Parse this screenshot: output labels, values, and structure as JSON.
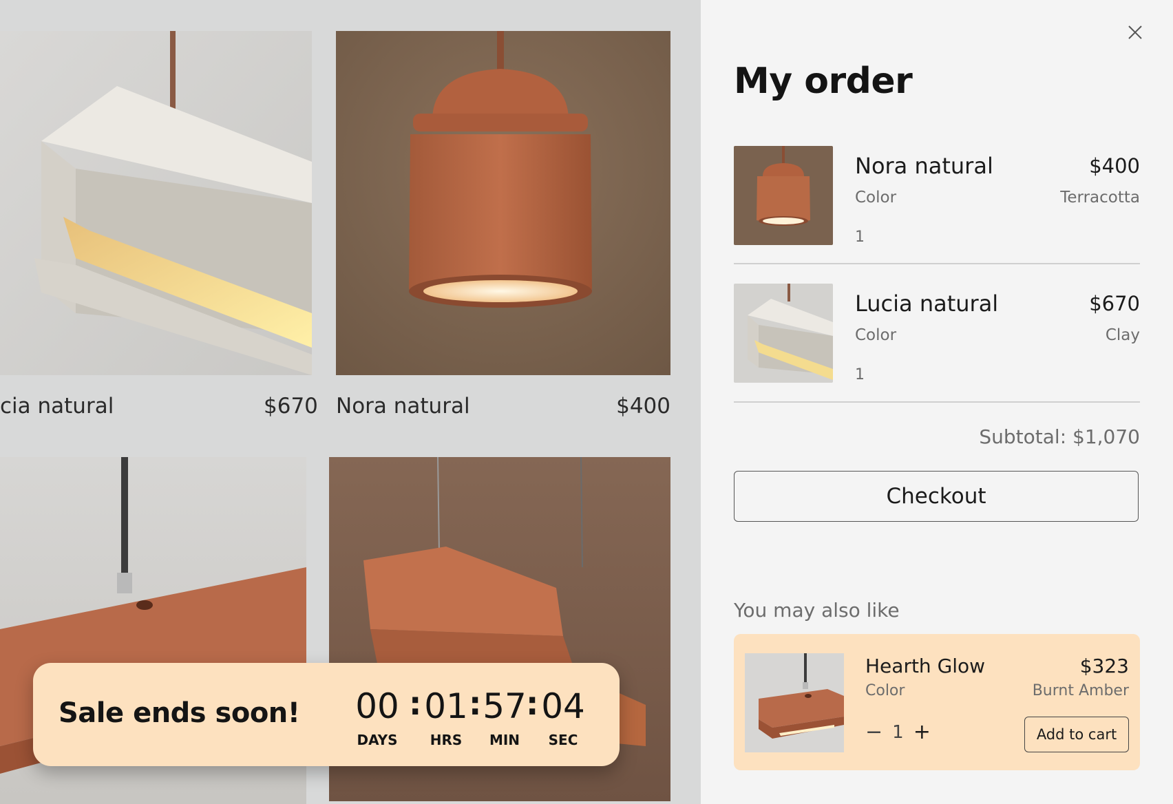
{
  "colors": {
    "banner": "#fde1bf",
    "panel": "#f4f4f4",
    "grid_bg": "#d8d9d9",
    "terracotta": "#b46646"
  },
  "grid": {
    "products": [
      {
        "name": "cia natural",
        "price": "$670"
      },
      {
        "name": "Nora natural",
        "price": "$400"
      }
    ]
  },
  "sale": {
    "text": "Sale ends soon!",
    "countdown": [
      {
        "value": "00",
        "label": "DAYS"
      },
      {
        "value": "01",
        "label": "HRS"
      },
      {
        "value": "57",
        "label": "MIN"
      },
      {
        "value": "04",
        "label": "SEC"
      }
    ],
    "separator": ":"
  },
  "order": {
    "title": "My order",
    "close_icon": "close-icon",
    "items": [
      {
        "name": "Nora natural",
        "price": "$400",
        "color_label": "Color",
        "color": "Terracotta",
        "qty": "1"
      },
      {
        "name": "Lucia natural",
        "price": "$670",
        "color_label": "Color",
        "color": "Clay",
        "qty": "1"
      }
    ],
    "subtotal": "Subtotal: $1,070",
    "checkout_label": "Checkout"
  },
  "recommend": {
    "heading": "You may also like",
    "item": {
      "name": "Hearth Glow",
      "price": "$323",
      "color_label": "Color",
      "color": "Burnt Amber",
      "qty": "1",
      "minus": "−",
      "plus": "+",
      "add_label": "Add to cart"
    }
  }
}
